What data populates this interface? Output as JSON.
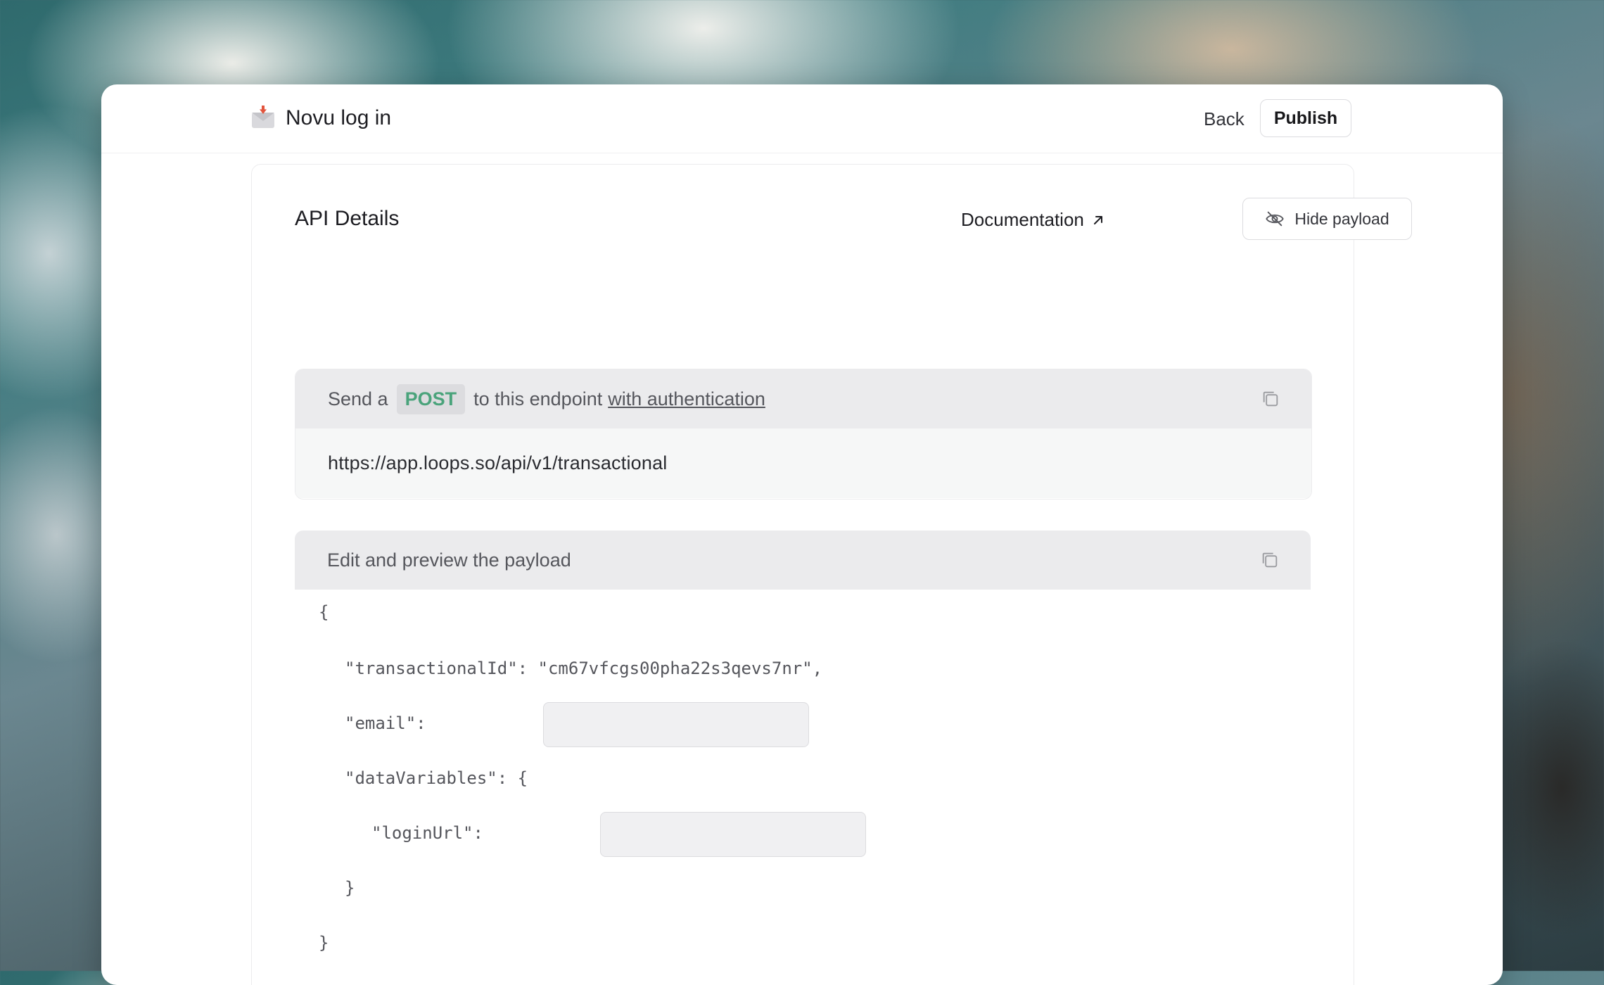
{
  "header": {
    "title": "Novu log in",
    "title_icon": "envelope-with-arrow-icon",
    "back_label": "Back",
    "publish_label": "Publish"
  },
  "api_details": {
    "title": "API Details",
    "documentation_label": "Documentation",
    "documentation_icon": "arrow-up-right-icon",
    "hide_payload_label": "Hide payload",
    "hide_payload_icon": "eye-off-icon"
  },
  "endpoint": {
    "prefix": "Send a",
    "method": "POST",
    "middle": "to this endpoint",
    "auth_link": "with authentication",
    "url": "https://app.loops.so/api/v1/transactional"
  },
  "payload": {
    "header": "Edit and preview the payload",
    "open_brace": "{",
    "transactional_line": "\"transactionalId\": \"cm67vfcgs00pha22s3qevs7nr\",",
    "email_key": "\"email\":",
    "email_value": "",
    "data_variables_line": "\"dataVariables\": {",
    "login_url_key": "\"loginUrl\":",
    "login_url_value": "",
    "inner_close": "}",
    "outer_close": "}"
  },
  "colors": {
    "method_green": "#4aa37b",
    "panel_header_bg": "#ebebed",
    "url_row_bg": "#f6f7f7"
  }
}
